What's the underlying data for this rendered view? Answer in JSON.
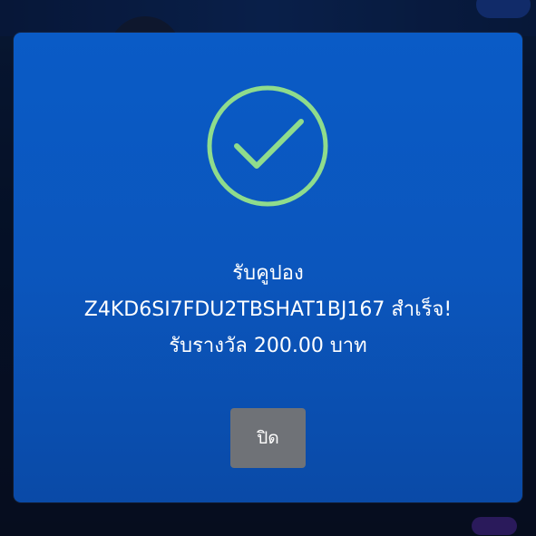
{
  "dialog": {
    "message_line1": "รับคูปอง",
    "message_line2": "Z4KD6SI7FDU2TBSHAT1BJ167 สำเร็จ!",
    "message_line3": "รับรางวัล 200.00 บาท",
    "close_label": "ปิด"
  },
  "icons": {
    "success": "check-circle-icon"
  },
  "colors": {
    "dialog_background": "#0a56bd",
    "check_color": "#8fdc8c",
    "close_button": "#6f7277",
    "text": "#ffffff"
  }
}
